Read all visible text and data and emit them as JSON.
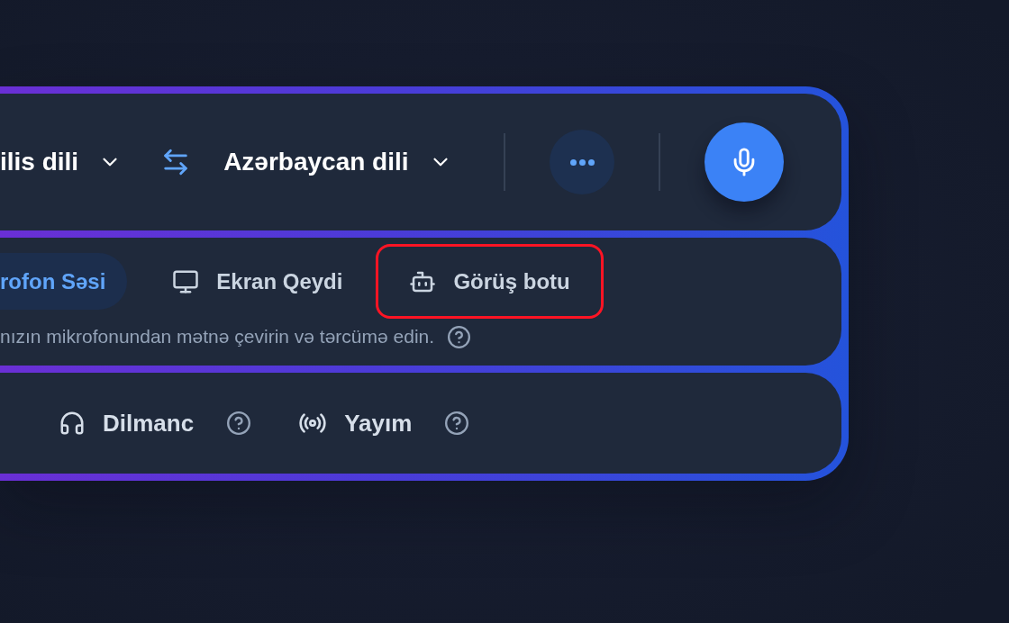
{
  "language_bar": {
    "source_language": "ilis dili",
    "target_language": "Azərbaycan dili"
  },
  "modes": [
    {
      "label": "rofon Səsi",
      "selected": true,
      "highlighted": false
    },
    {
      "label": "Ekran Qeydi",
      "selected": false,
      "highlighted": false
    },
    {
      "label": "Görüş botu",
      "selected": false,
      "highlighted": true
    }
  ],
  "mode_description": "nızın mikrofonundan mətnə çevirin və tərcümə edin.",
  "features": [
    {
      "label": "Dilmanc"
    },
    {
      "label": "Yayım"
    }
  ]
}
